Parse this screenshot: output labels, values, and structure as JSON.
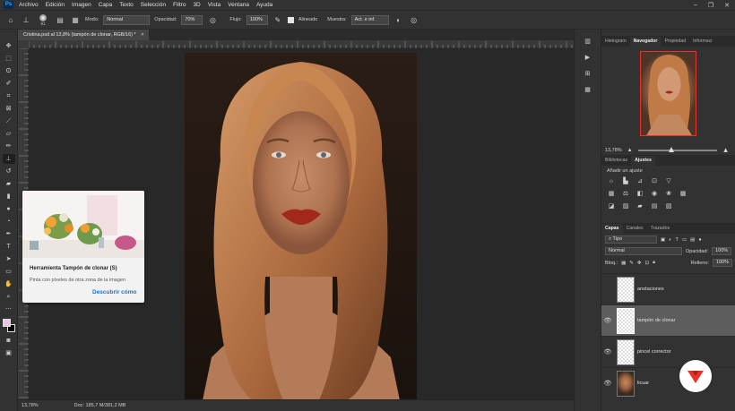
{
  "menubar": {
    "logo": "Ps",
    "items": [
      "Archivo",
      "Edición",
      "Imagen",
      "Capa",
      "Texto",
      "Selección",
      "Filtro",
      "3D",
      "Vista",
      "Ventana",
      "Ayuda"
    ],
    "win_controls": [
      "–",
      "❐",
      "✕"
    ]
  },
  "optionsbar": {
    "brush_size": "81",
    "mode_label": "Modo:",
    "mode_value": "Normal",
    "opacity_label": "Opacidad:",
    "opacity_value": "70%",
    "flow_label": "Flujo:",
    "flow_value": "100%",
    "aligned_label": "Alineado",
    "sample_label": "Muestra:",
    "sample_value": "Act. e inf."
  },
  "document": {
    "tab_title": "Cristina.psd al 13,8% (tampón de clonar, RGB/16) *",
    "tab_close": "×"
  },
  "tooltip": {
    "title": "Herramienta Tampón de clonar (S)",
    "description": "Pinta con píxeles de otra zona de la imagen",
    "link": "Descubrir cómo"
  },
  "statusbar": {
    "zoom": "13,78%",
    "doc_info": "Doc: 185,7 M/381,2 MB"
  },
  "panels": {
    "top_tabs": [
      "Histogram",
      "Navegador",
      "Propiedad",
      "Informaci"
    ],
    "active_top_tab": "Navegador",
    "nav_zoom": "13,78%",
    "nav_zoom_fraction": 0.42,
    "adj_tabs": [
      "Bibliotecas",
      "Ajustes"
    ],
    "active_adj_tab": "Ajustes",
    "adj_title": "Añadir un ajuste",
    "layer_tabs": [
      "Capas",
      "Canales",
      "Trazados"
    ],
    "active_layer_tab": "Capas",
    "filter_value": "Tipo",
    "blend_value": "Normal",
    "opacity_label": "Opacidad:",
    "opacity_value": "100%",
    "lock_label": "Bloq.:",
    "fill_label": "Relleno:",
    "fill_value": "100%",
    "layers": [
      {
        "name": "anotaciones",
        "visible": false,
        "selected": false,
        "thumb": "transparent"
      },
      {
        "name": "tampón de clonar",
        "visible": true,
        "selected": true,
        "thumb": "transparent"
      },
      {
        "name": "pincel corrector",
        "visible": true,
        "selected": false,
        "thumb": "transparent"
      },
      {
        "name": "licuar",
        "visible": true,
        "selected": false,
        "thumb": "photo"
      }
    ]
  },
  "colors": {
    "foreground": "#e8c9e3",
    "background": "#000000",
    "accent_link": "#1473e6",
    "navigator_frame": "#e8332a",
    "brand": "#e8332a"
  }
}
